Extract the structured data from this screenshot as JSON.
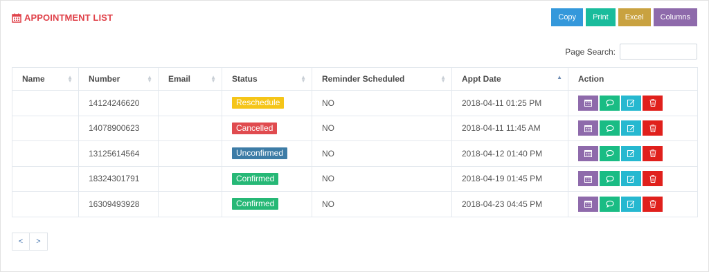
{
  "header": {
    "title": "APPOINTMENT LIST",
    "icon": "calendar-icon",
    "title_color": "#e0424a"
  },
  "toolbar": {
    "buttons": [
      {
        "label": "Copy",
        "color": "#3498db"
      },
      {
        "label": "Print",
        "color": "#1abc9c"
      },
      {
        "label": "Excel",
        "color": "#c9a240"
      },
      {
        "label": "Columns",
        "color": "#8e6aab"
      }
    ]
  },
  "search": {
    "label": "Page Search:",
    "value": "",
    "placeholder": ""
  },
  "table": {
    "columns": [
      "Name",
      "Number",
      "Email",
      "Status",
      "Reminder Scheduled",
      "Appt Date",
      "Action"
    ],
    "sorted_column": "Appt Date",
    "rows": [
      {
        "name": "",
        "number": "14124246620",
        "email": "",
        "status": "Reschedule",
        "reminder": "NO",
        "appt_date": "2018-04-11 01:25 PM"
      },
      {
        "name": "",
        "number": "14078900623",
        "email": "",
        "status": "Cancelled",
        "reminder": "NO",
        "appt_date": "2018-04-11 11:45 AM"
      },
      {
        "name": "",
        "number": "13125614564",
        "email": "",
        "status": "Unconfirmed",
        "reminder": "NO",
        "appt_date": "2018-04-12 01:40 PM"
      },
      {
        "name": "",
        "number": "18324301791",
        "email": "",
        "status": "Confirmed",
        "reminder": "NO",
        "appt_date": "2018-04-19 01:45 PM"
      },
      {
        "name": "",
        "number": "16309493928",
        "email": "",
        "status": "Confirmed",
        "reminder": "NO",
        "appt_date": "2018-04-23 04:45 PM"
      }
    ],
    "status_colors": {
      "Reschedule": "#f5c518",
      "Cancelled": "#e04b4f",
      "Unconfirmed": "#3d7ca6",
      "Confirmed": "#26b876"
    },
    "action_buttons": [
      {
        "icon": "calendar-icon",
        "color": "#8e6aab"
      },
      {
        "icon": "chat-bubble-icon",
        "color": "#1abc84"
      },
      {
        "icon": "edit-icon",
        "color": "#26b8d0"
      },
      {
        "icon": "trash-icon",
        "color": "#e0201c"
      }
    ]
  },
  "pagination": {
    "prev": "<",
    "next": ">"
  }
}
